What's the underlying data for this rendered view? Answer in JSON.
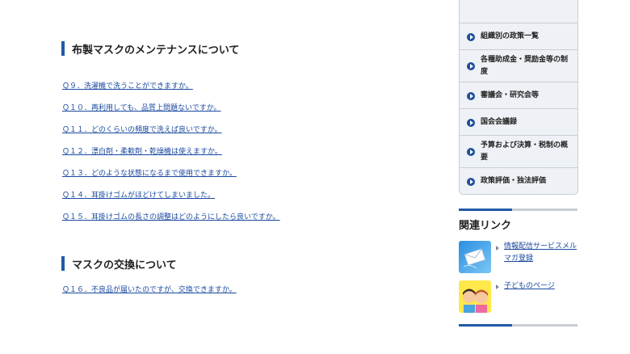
{
  "main": {
    "section1_title": "布製マスクのメンテナンスについて",
    "section1_links": [
      "Ｑ９．洗濯機で洗うことができますか。",
      "Ｑ１０．再利用しても、品質上問題ないですか。",
      "Ｑ１１．どのくらいの頻度で洗えば良いですか。",
      "Ｑ１２．漂白剤・柔軟剤・乾燥機は使えますか。",
      "Ｑ１３．どのような状態になるまで使用できますか。",
      "Ｑ１４．耳掛けゴムがほどけてしまいました。",
      "Ｑ１５．耳掛けゴムの長さの調整はどのようにしたら良いですか。"
    ],
    "section2_title": "マスクの交換について",
    "section2_links": [
      "Ｑ１６．不良品が届いたのですが、交換できますか。"
    ]
  },
  "sidebar": {
    "menu_items": [
      "組織別の政策一覧",
      "各種助成金・奨励金等の制度",
      "審議会・研究会等",
      "国会会議録",
      "予算および決算・税制の概要",
      "政策評価・独法評価"
    ],
    "related_title": "関連リンク",
    "related_links": [
      "情報配信サービスメルマガ登録",
      "子どものページ"
    ]
  }
}
